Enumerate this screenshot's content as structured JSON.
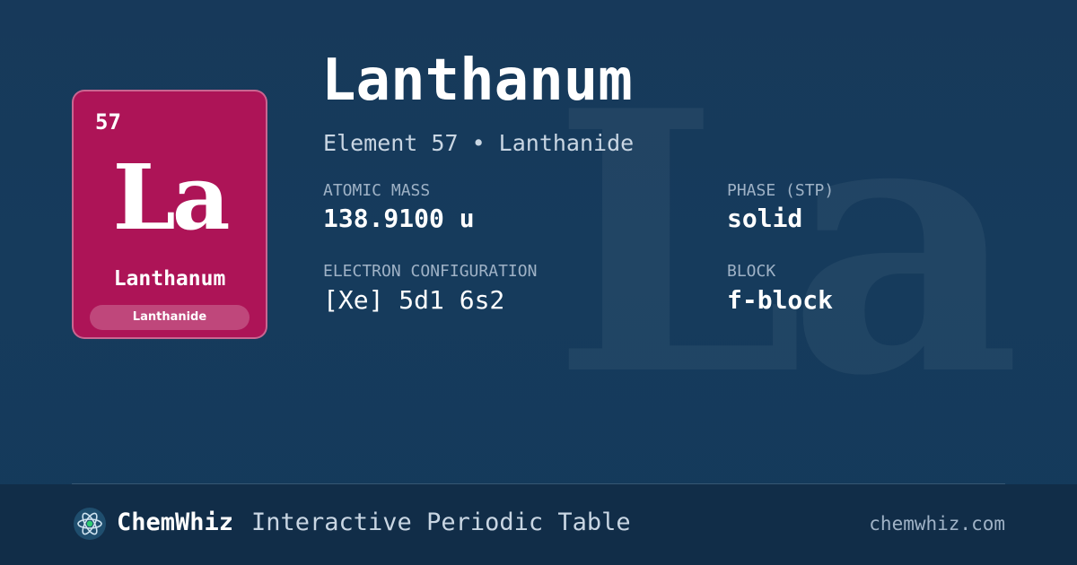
{
  "watermark": "La",
  "card": {
    "number": "57",
    "symbol": "La",
    "name": "Lanthanum",
    "category": "Lanthanide",
    "color": "#ad1457"
  },
  "element": {
    "name": "Lanthanum",
    "subtitle": "Element 57 • Lanthanide"
  },
  "properties": {
    "atomic_mass": {
      "label": "ATOMIC MASS",
      "value": "138.9100 u"
    },
    "phase": {
      "label": "PHASE (STP)",
      "value": "solid"
    },
    "electron_configuration": {
      "label": "ELECTRON CONFIGURATION",
      "value": "[Xe] 5d1 6s2"
    },
    "block": {
      "label": "BLOCK",
      "value": "f-block"
    }
  },
  "footer": {
    "logo_icon": "atom-icon",
    "brand": "ChemWhiz",
    "tagline": "Interactive Periodic Table",
    "site": "chemwhiz.com"
  }
}
